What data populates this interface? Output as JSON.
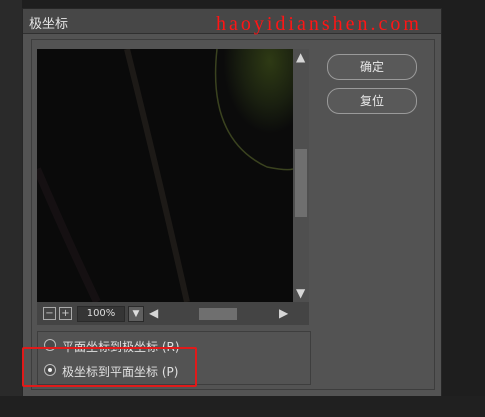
{
  "dialog": {
    "title": "极坐标",
    "watermark": "haoyidianshen.com"
  },
  "preview": {
    "zoom_level": "100%",
    "zoom_out_label": "−",
    "zoom_in_label": "+"
  },
  "buttons": {
    "ok_label": "确定",
    "reset_label": "复位"
  },
  "options": {
    "items": [
      {
        "label": "平面坐标到极坐标 (R)",
        "selected": false
      },
      {
        "label": "极坐标到平面坐标 (P)",
        "selected": true
      }
    ]
  },
  "colors": {
    "dialog_bg": "#535353",
    "highlight_border": "#e01a1a",
    "watermark": "#ff1515"
  }
}
